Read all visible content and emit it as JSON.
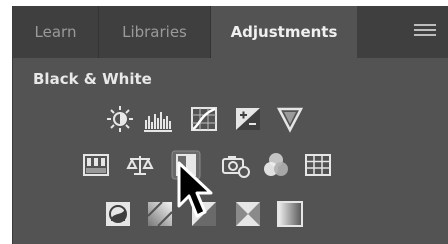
{
  "tabs": [
    {
      "label": "Learn",
      "active": false
    },
    {
      "label": "Libraries",
      "active": false
    },
    {
      "label": "Adjustments",
      "active": true
    }
  ],
  "panel_title": "Black & White",
  "icons": {
    "row1": [
      "brightness-contrast-icon",
      "levels-icon",
      "curves-icon",
      "exposure-icon",
      "vibrance-icon"
    ],
    "row2": [
      "hue-saturation-icon",
      "color-balance-icon",
      "black-white-icon",
      "photo-filter-icon",
      "channel-mixer-icon",
      "color-lookup-icon"
    ],
    "row3": [
      "invert-icon",
      "posterize-icon",
      "threshold-icon",
      "selective-color-icon",
      "gradient-map-icon"
    ]
  },
  "colors": {
    "panel_bg": "#535353",
    "tab_bar_bg": "#3f3f3f",
    "active_tab_text": "#f0f0f0",
    "icon_fill": "#e6e6e6"
  }
}
